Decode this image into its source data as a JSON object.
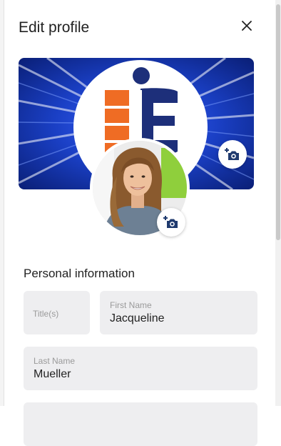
{
  "header": {
    "title": "Edit profile",
    "close_icon": "close-icon"
  },
  "cover": {
    "camera_icon": "add-photo-icon"
  },
  "avatar": {
    "camera_icon": "add-photo-icon"
  },
  "personal_information": {
    "heading": "Personal information",
    "title_field": {
      "placeholder": "Title(s)",
      "value": ""
    },
    "first_name": {
      "label": "First Name",
      "value": "Jacqueline"
    },
    "last_name": {
      "label": "Last Name",
      "value": "Mueller"
    }
  },
  "colors": {
    "cover_blue": "#1a3fc4",
    "logo_orange": "#ef6c24",
    "logo_navy": "#1d2f7a",
    "field_bg": "#eeeef0"
  }
}
